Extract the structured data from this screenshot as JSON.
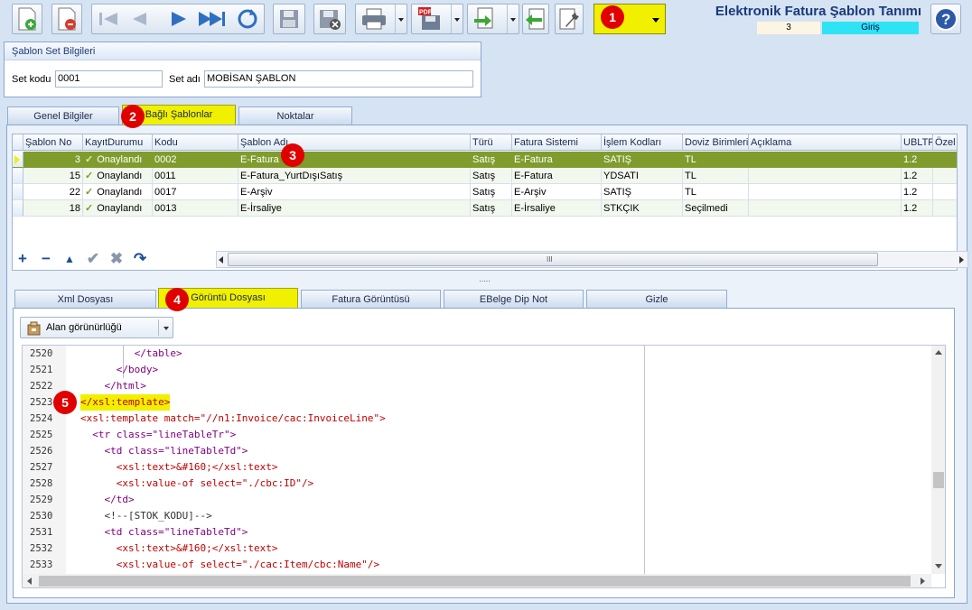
{
  "header": {
    "title": "Elektronik Fatura Şablon Tanımı",
    "record_number": "3",
    "mode": "Giriş"
  },
  "badges": [
    "1",
    "2",
    "3",
    "4",
    "5"
  ],
  "set_panel": {
    "title": "Şablon Set Bilgileri",
    "set_kodu_label": "Set kodu",
    "set_kodu_value": "0001",
    "set_adi_label": "Set adı",
    "set_adi_value": "MOBİSAN ŞABLON"
  },
  "tabs": {
    "genel": "Genel Bilgiler",
    "bagli": "Bağlı Şablonlar",
    "noktalar": "Noktalar"
  },
  "grid": {
    "columns": [
      "Şablon No",
      "KayıtDurumu",
      "Kodu",
      "Şablon Adı",
      "Türü",
      "Fatura Sistemi",
      "İşlem Kodları",
      "Doviz Birimleri",
      "Açıklama",
      "UBLTR",
      "Özel F"
    ],
    "rows": [
      {
        "no": "3",
        "durum": "Onaylandı",
        "kodu": "0002",
        "adi": "E-Fatura",
        "turu": "Satış",
        "sistem": "E-Fatura",
        "islem": "SATIŞ",
        "doviz": "TL",
        "aciklama": "",
        "ubltr": "1.2"
      },
      {
        "no": "15",
        "durum": "Onaylandı",
        "kodu": "0011",
        "adi": "E-Fatura_YurtDışıSatış",
        "turu": "Satış",
        "sistem": "E-Fatura",
        "islem": "YDSATI",
        "doviz": "TL",
        "aciklama": "",
        "ubltr": "1.2"
      },
      {
        "no": "22",
        "durum": "Onaylandı",
        "kodu": "0017",
        "adi": "E-Arşiv",
        "turu": "Satış",
        "sistem": "E-Arşiv",
        "islem": "SATIŞ",
        "doviz": "TL",
        "aciklama": "",
        "ubltr": "1.2"
      },
      {
        "no": "18",
        "durum": "Onaylandı",
        "kodu": "0013",
        "adi": "E-İrsaliye",
        "turu": "Satış",
        "sistem": "E-İrsaliye",
        "islem": "STKÇIK",
        "doviz": "Seçilmedi",
        "aciklama": "",
        "ubltr": "1.2"
      }
    ],
    "scroll_glyph": "III"
  },
  "splitter_glyph": ".....",
  "lower_tabs": {
    "xml": "Xml Dosyası",
    "goruntu": "Görüntü Dosyası",
    "fatura": "Fatura Görüntüsü",
    "dipnot": "EBelge Dip Not",
    "gizle": "Gizle"
  },
  "combo": {
    "label": "Alan görünürlüğü"
  },
  "code": {
    "lines": [
      {
        "n": "2520",
        "t": "         </table>"
      },
      {
        "n": "2521",
        "t": "      </body>"
      },
      {
        "n": "2522",
        "t": "    </html>"
      },
      {
        "n": "2523",
        "t": "</xsl:template>"
      },
      {
        "n": "2524",
        "t": "<xsl:template match=\"//n1:Invoice/cac:InvoiceLine\">"
      },
      {
        "n": "2525",
        "t": "  <tr class=\"lineTableTr\">"
      },
      {
        "n": "2526",
        "t": "    <td class=\"lineTableTd\">"
      },
      {
        "n": "2527",
        "t": "      <xsl:text>&#160;</xsl:text>"
      },
      {
        "n": "2528",
        "t": "      <xsl:value-of select=\"./cbc:ID\"/>"
      },
      {
        "n": "2529",
        "t": "    </td>"
      },
      {
        "n": "2530",
        "t": "    <!--[STOK_KODU]-->"
      },
      {
        "n": "2531",
        "t": "    <td class=\"lineTableTd\">"
      },
      {
        "n": "2532",
        "t": "      <xsl:text>&#160;</xsl:text>"
      },
      {
        "n": "2533",
        "t": "      <xsl:value-of select=\"./cac:Item/cbc:Name\"/>"
      }
    ]
  },
  "colors": {
    "highlight": "#f0f000",
    "selected_row": "#7f9c2c",
    "badge": "#e00000",
    "mode_badge": "#2ee4f4"
  }
}
